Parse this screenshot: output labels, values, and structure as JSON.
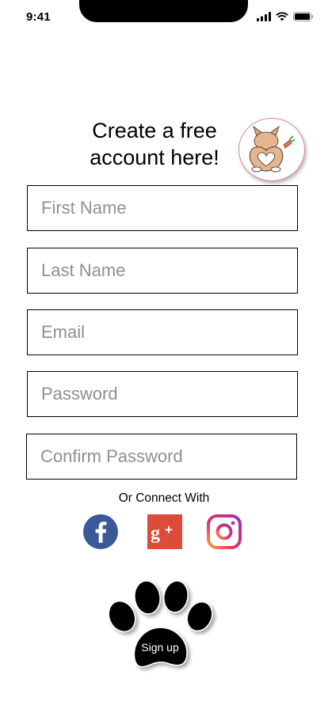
{
  "status_bar": {
    "time": "9:41"
  },
  "header": {
    "title_line1": "Create a free",
    "title_line2": "account here!"
  },
  "form": {
    "first_name": {
      "placeholder": "First Name",
      "value": ""
    },
    "last_name": {
      "placeholder": "Last Name",
      "value": ""
    },
    "email": {
      "placeholder": "Email",
      "value": ""
    },
    "password": {
      "placeholder": "Password",
      "value": ""
    },
    "confirm_password": {
      "placeholder": "Confirm Password",
      "value": ""
    }
  },
  "connect": {
    "label": "Or Connect With",
    "providers": [
      {
        "name": "facebook",
        "icon": "facebook-icon",
        "color": "#3b5998"
      },
      {
        "name": "google-plus",
        "icon": "google-plus-icon",
        "color": "#dd4b39"
      },
      {
        "name": "instagram",
        "icon": "instagram-icon",
        "color": "#c13584"
      }
    ]
  },
  "signup": {
    "label": "Sign up",
    "icon": "paw-icon"
  },
  "colors": {
    "accent": "#000000",
    "mascot_border": "#d98b8b"
  }
}
